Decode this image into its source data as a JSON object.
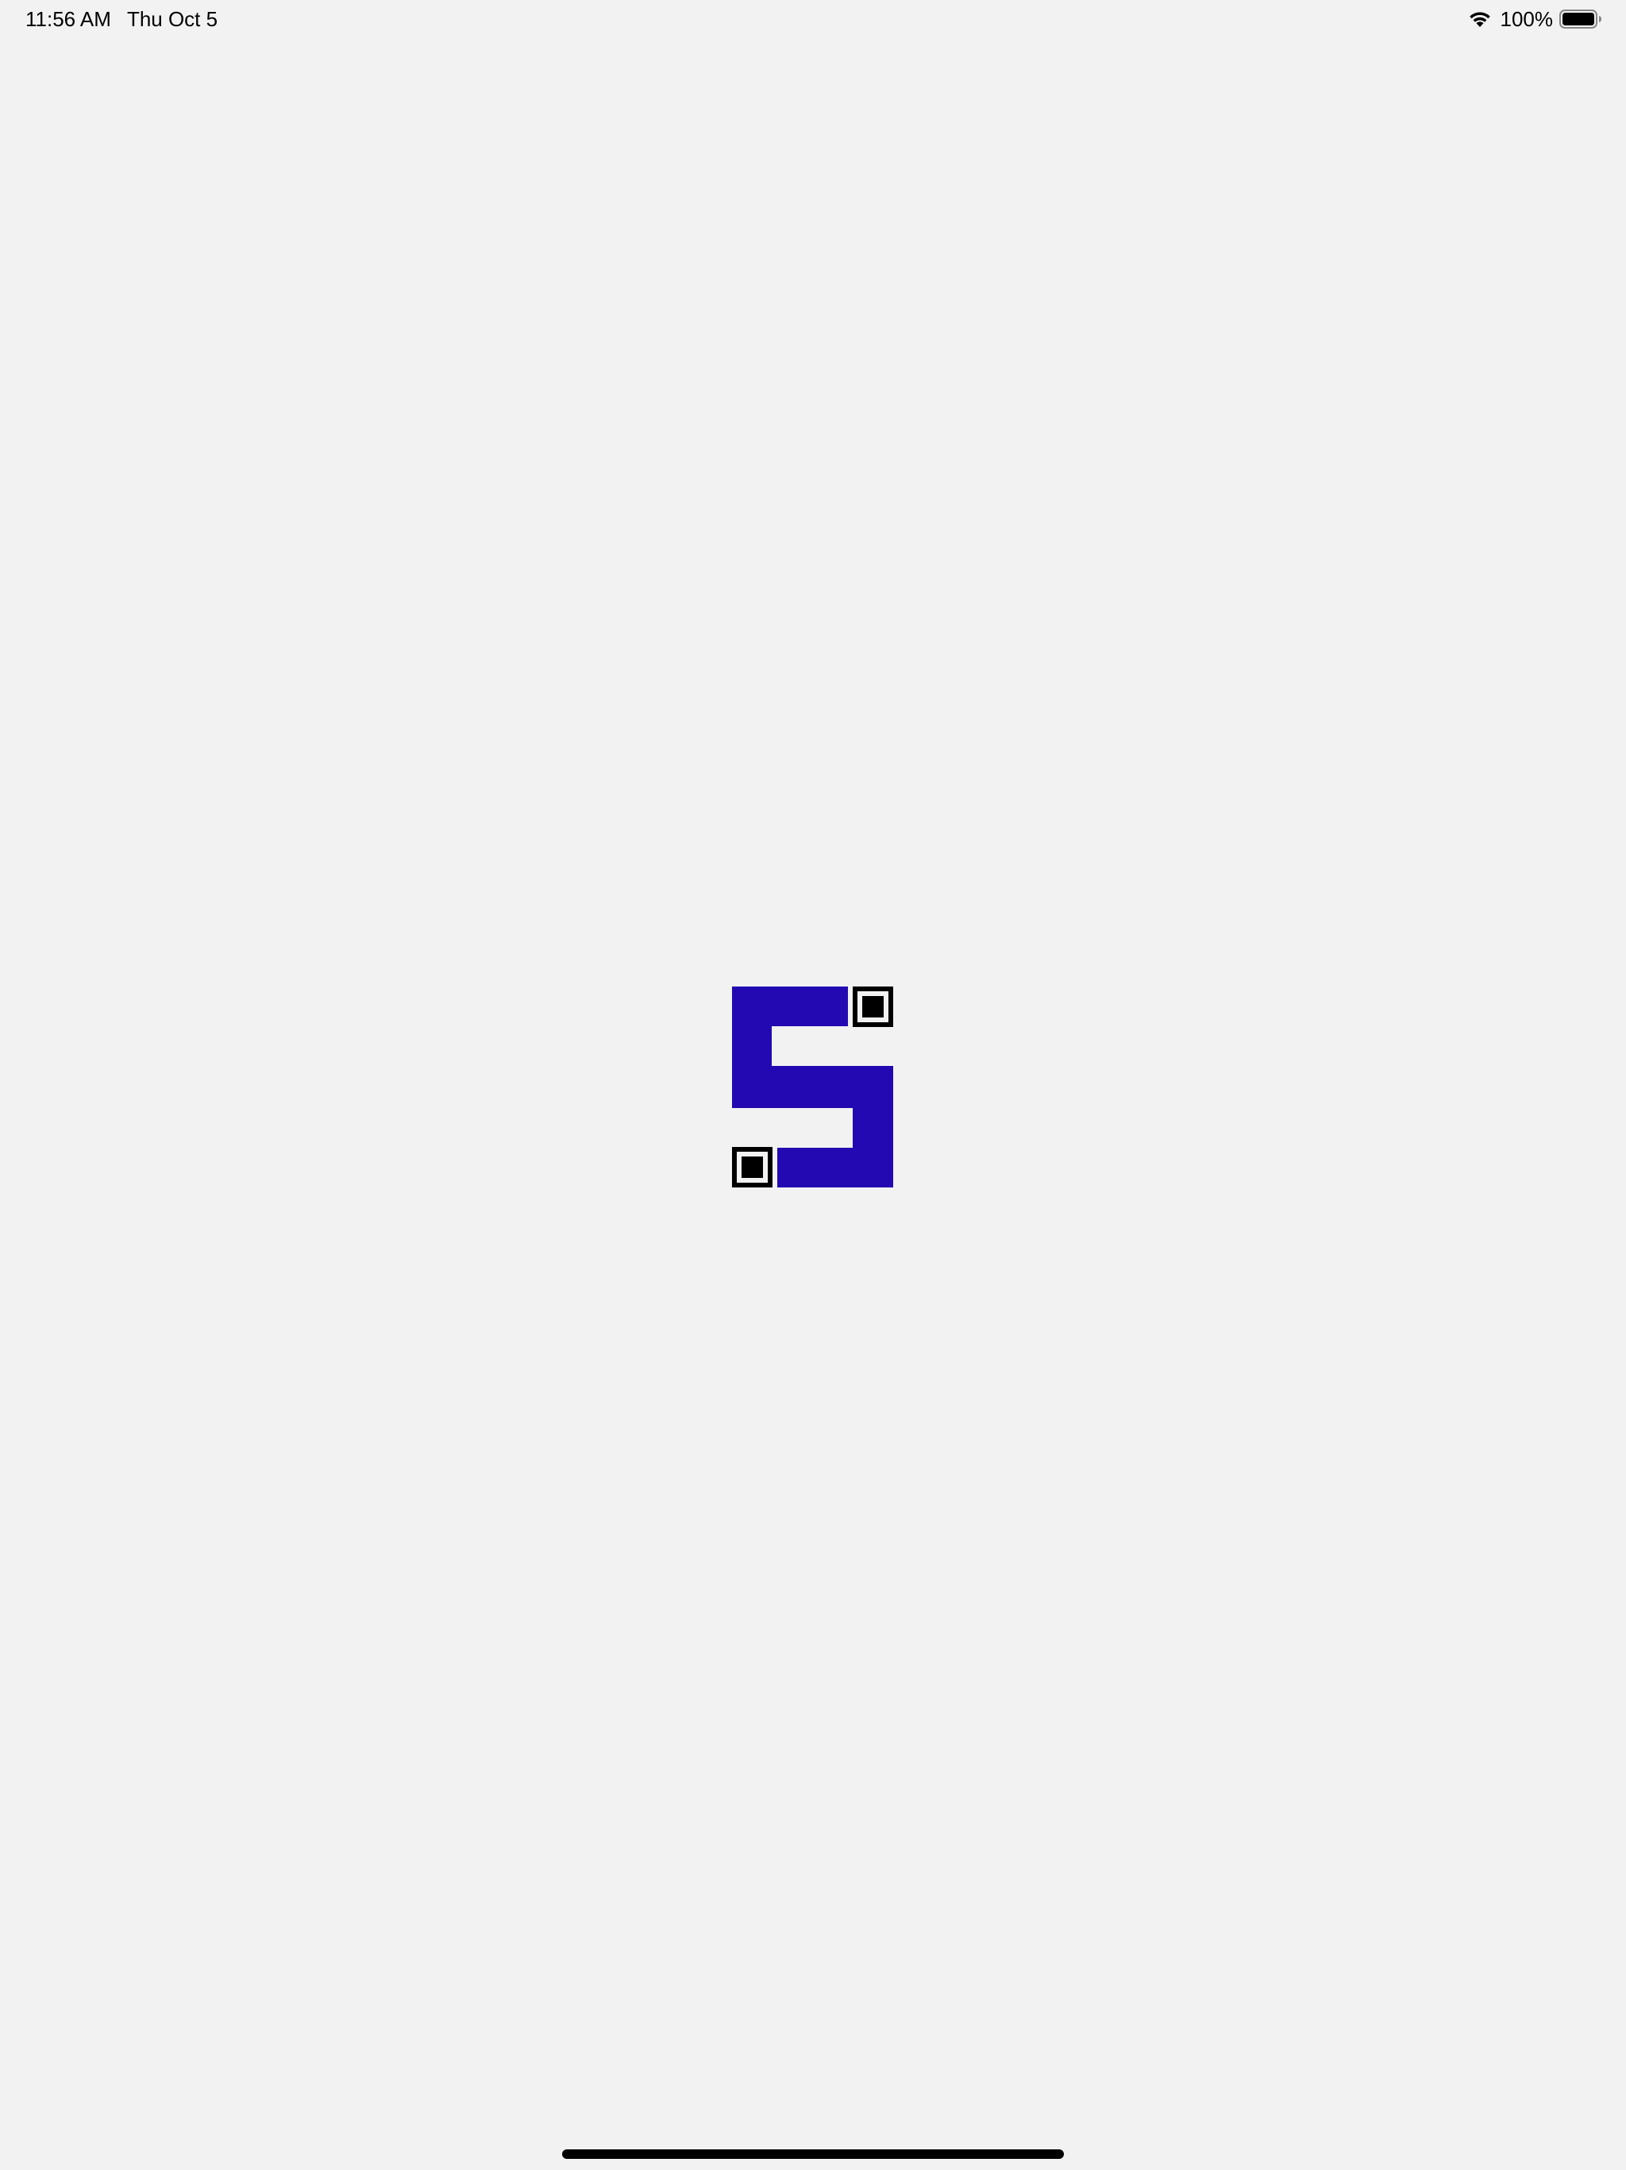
{
  "status_bar": {
    "time": "11:56 AM",
    "date": "Thu Oct 5",
    "battery_percent": "100%",
    "battery_level": 1.0,
    "wifi_icon": "wifi-icon",
    "battery_icon": "battery-full-icon"
  },
  "splash": {
    "logo_icon": "app-logo-icon",
    "logo_color": "#2309b2",
    "marker_color": "#000000"
  },
  "colors": {
    "background": "#f2f2f2"
  }
}
